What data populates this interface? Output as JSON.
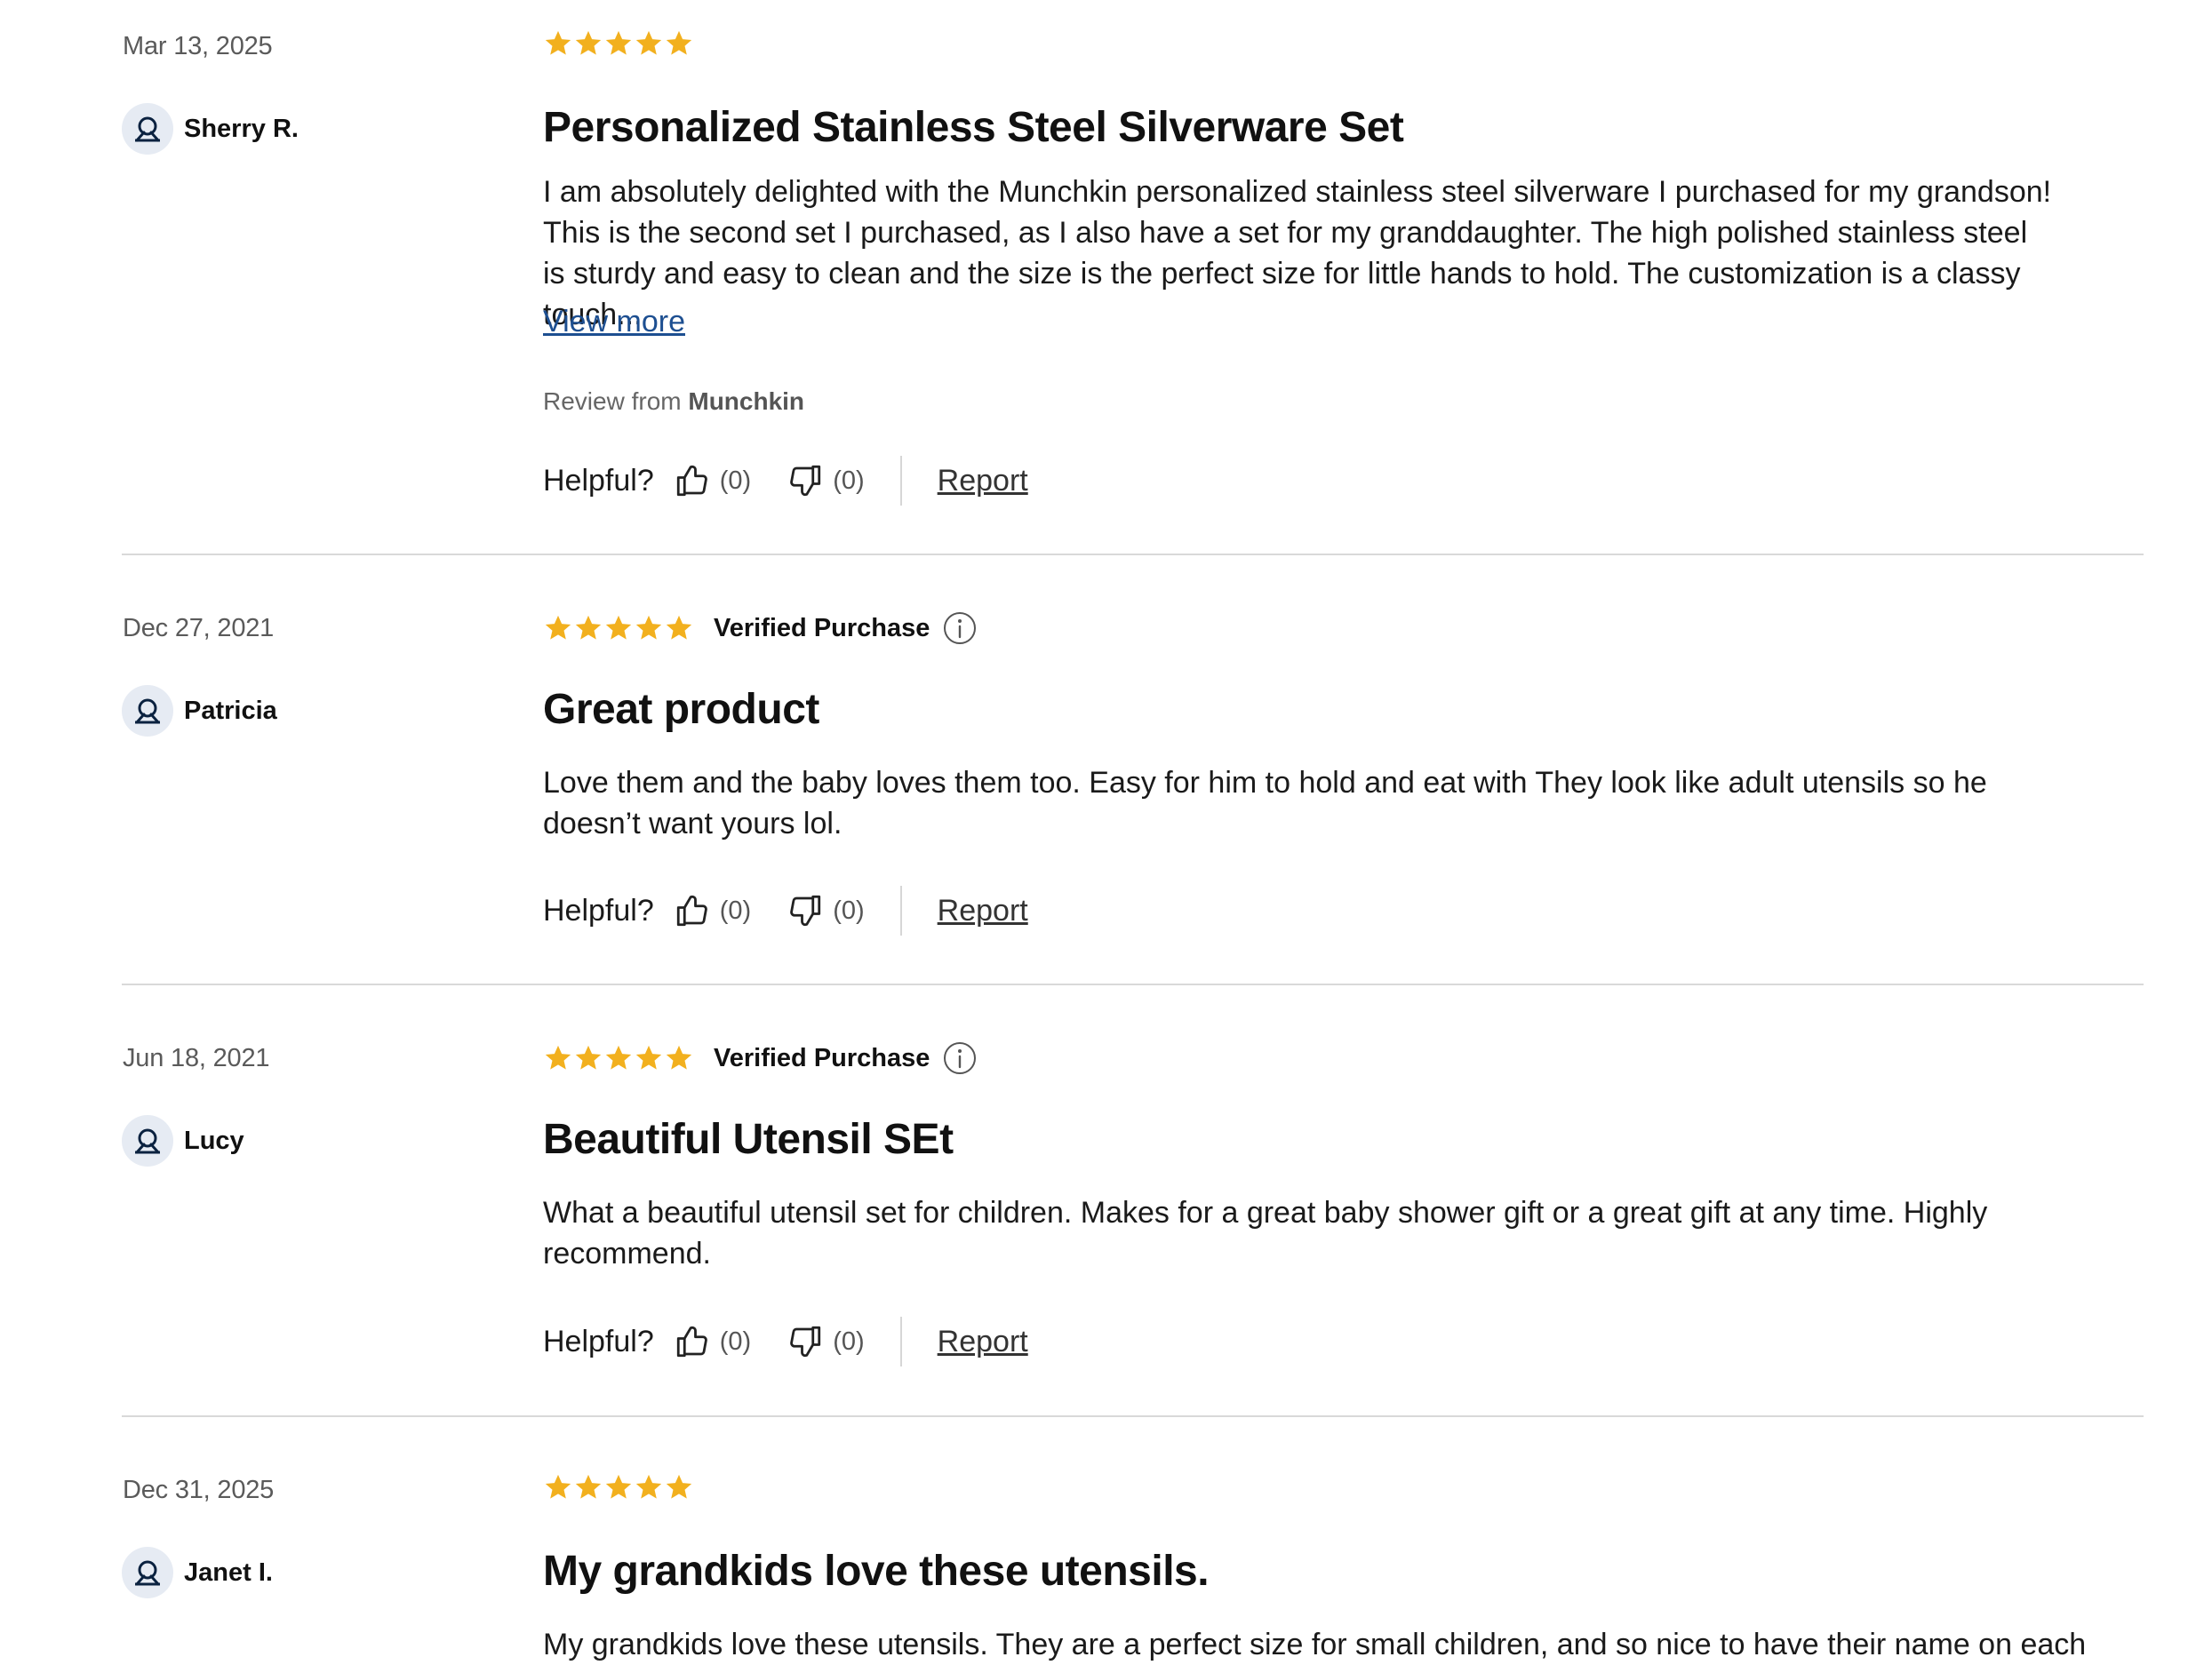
{
  "labels": {
    "helpful": "Helpful?",
    "report": "Report",
    "view_more": "View more",
    "review_from": "Review from",
    "verified": "Verified Purchase"
  },
  "colors": {
    "star": "#f2b01e",
    "link": "#1d4f91",
    "avatar_bg": "#e6ebf3",
    "avatar_icon": "#0b2240"
  },
  "reviews": [
    {
      "date": "Mar 13, 2025",
      "user": "Sherry R.",
      "rating": 5,
      "verified": false,
      "title": "Personalized Stainless Steel Silverware Set",
      "body": "I am absolutely delighted with the Munchkin personalized stainless steel silverware I purchased for my grandson! This is the second set I purchased, as I also have a set for my granddaughter. The high polished stainless steel is sturdy and easy to clean and the size is the perfect size for little hands to hold.  The customization is a classy touch...",
      "has_view_more": true,
      "source": "Munchkin",
      "up": "(0)",
      "down": "(0)"
    },
    {
      "date": "Dec 27, 2021",
      "user": "Patricia",
      "rating": 5,
      "verified": true,
      "title": "Great product",
      "body": "Love them and the baby loves them too. Easy for him to hold and eat with They look like adult utensils so he doesn’t want yours lol.",
      "has_view_more": false,
      "up": "(0)",
      "down": "(0)"
    },
    {
      "date": "Jun 18, 2021",
      "user": "Lucy",
      "rating": 5,
      "verified": true,
      "title": "Beautiful Utensil SEt",
      "body": "What a beautiful utensil set for children. Makes for a great baby shower gift or a great gift at any time. Highly recommend.",
      "has_view_more": false,
      "up": "(0)",
      "down": "(0)"
    },
    {
      "date": "Dec 31, 2025",
      "user": "Janet I.",
      "rating": 5,
      "verified": false,
      "title": "My grandkids love these utensils.",
      "body": "My grandkids love these utensils. They are a perfect size for small children, and so nice to have their name on each",
      "has_view_more": false
    }
  ]
}
